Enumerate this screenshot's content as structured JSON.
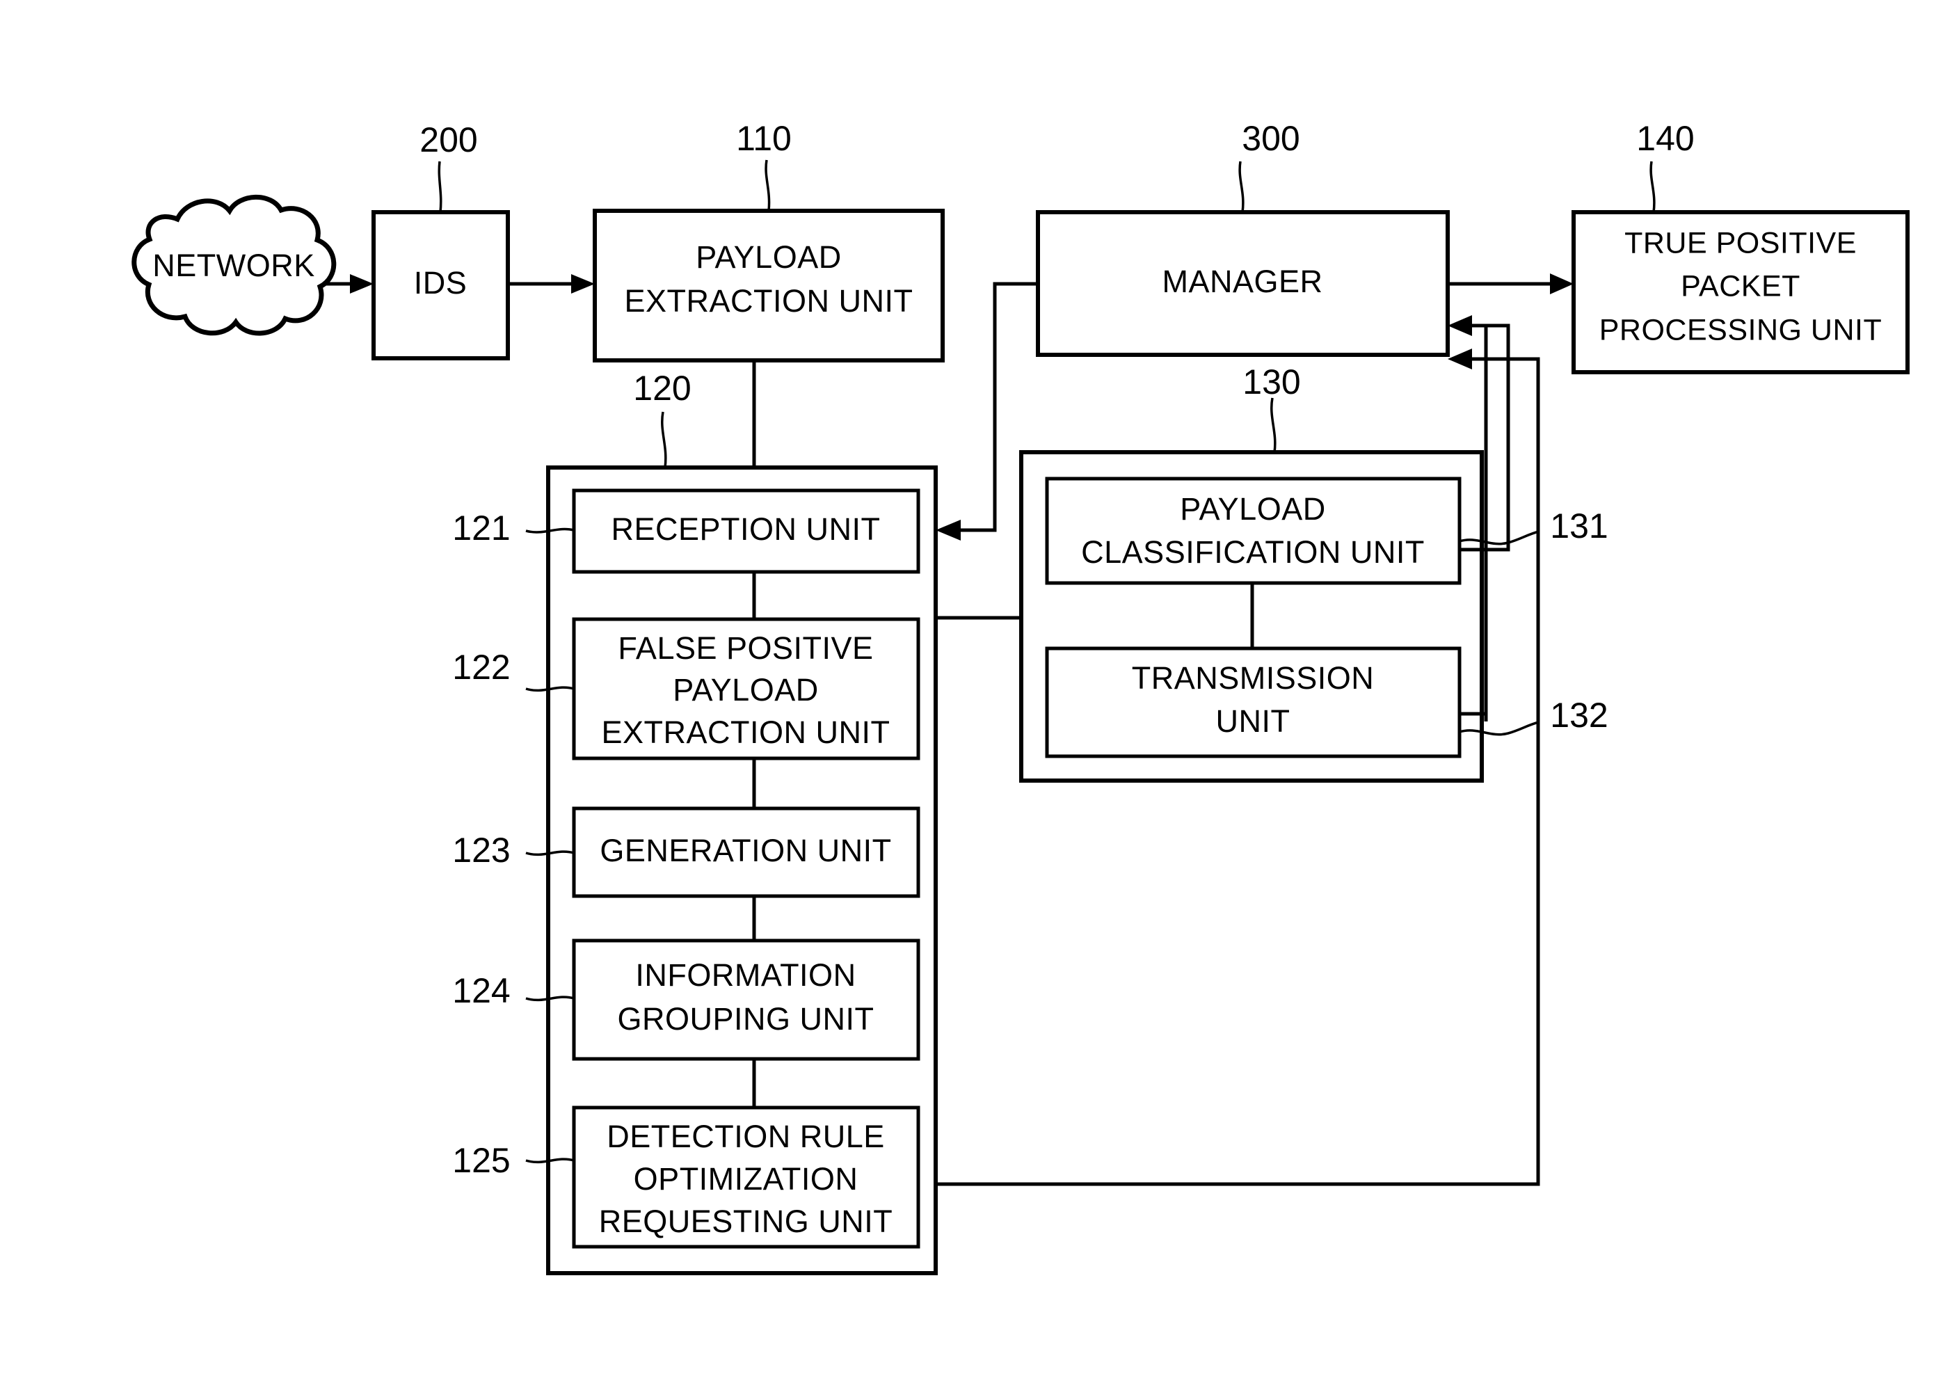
{
  "figure": {
    "type": "patent-block-diagram",
    "background": "#ffffff",
    "line_color": "#000000"
  },
  "nodes": {
    "network": {
      "label": "NETWORK",
      "shape": "cloud"
    },
    "ids": {
      "label": "IDS",
      "ref": "200"
    },
    "payload_extraction": {
      "line1": "PAYLOAD",
      "line2": "EXTRACTION UNIT",
      "ref": "110"
    },
    "manager": {
      "label": "MANAGER",
      "ref": "300"
    },
    "true_positive": {
      "line1": "TRUE POSITIVE",
      "line2": "PACKET",
      "line3": "PROCESSING UNIT",
      "ref": "140"
    },
    "group_120": {
      "ref": "120"
    },
    "group_130": {
      "ref": "130"
    },
    "reception": {
      "label": "RECEPTION UNIT",
      "ref": "121"
    },
    "false_positive_payload": {
      "line1": "FALSE POSITIVE",
      "line2": "PAYLOAD",
      "line3": "EXTRACTION UNIT",
      "ref": "122"
    },
    "generation": {
      "label": "GENERATION UNIT",
      "ref": "123"
    },
    "information_grouping": {
      "line1": "INFORMATION",
      "line2": "GROUPING UNIT",
      "ref": "124"
    },
    "detection_rule": {
      "line1": "DETECTION RULE",
      "line2": "OPTIMIZATION",
      "line3": "REQUESTING UNIT",
      "ref": "125"
    },
    "payload_classification": {
      "line1": "PAYLOAD",
      "line2": "CLASSIFICATION UNIT",
      "ref": "131"
    },
    "transmission": {
      "line1": "TRANSMISSION",
      "line2": "UNIT",
      "ref": "132"
    }
  },
  "reference_numerals": [
    "200",
    "110",
    "300",
    "140",
    "120",
    "130",
    "121",
    "122",
    "123",
    "124",
    "125",
    "131",
    "132"
  ]
}
